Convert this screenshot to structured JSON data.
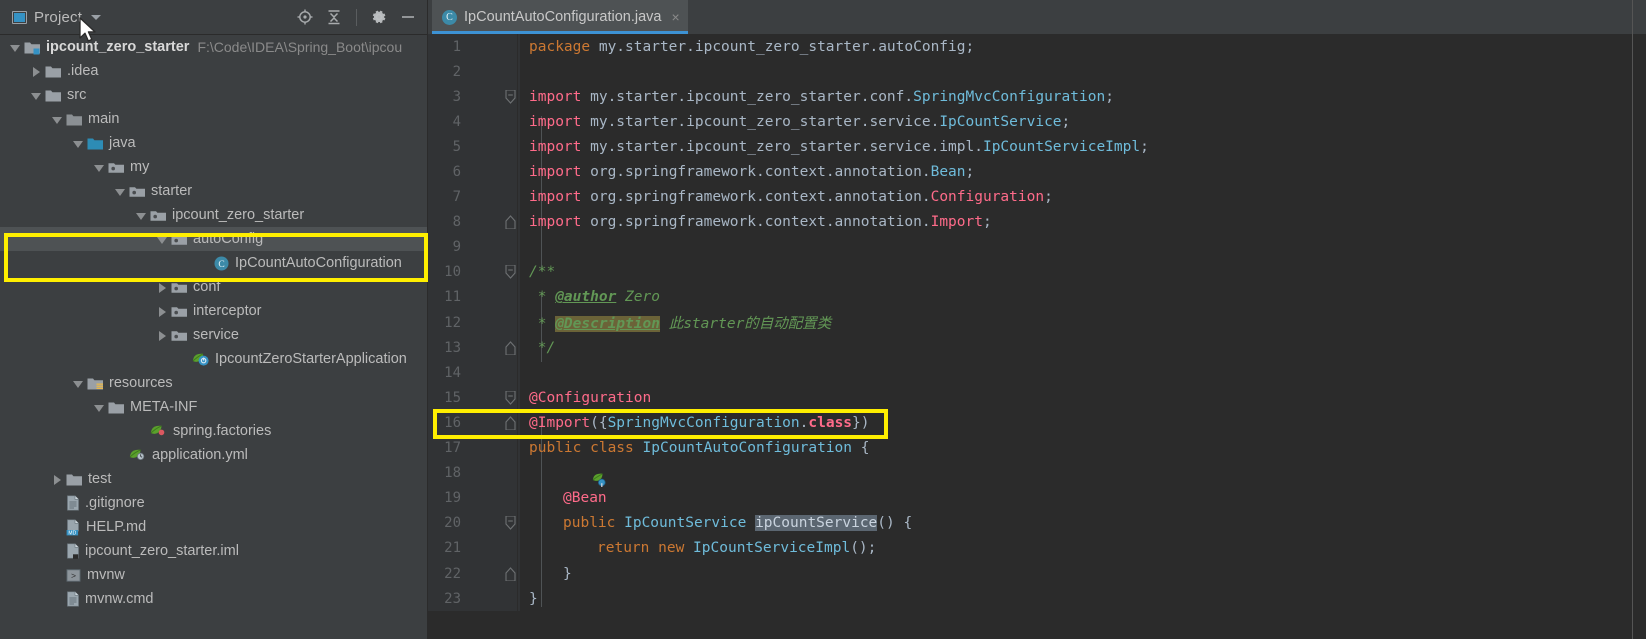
{
  "project_panel": {
    "title": "Project",
    "window_icon": "project-window-icon",
    "dropdown_icon": "chevron-down-icon",
    "toolbar": [
      {
        "name": "locate-icon",
        "tooltip": "Select Opened File"
      },
      {
        "name": "collapse-all-icon",
        "tooltip": "Collapse All"
      },
      {
        "name": "gear-icon",
        "tooltip": "Settings"
      },
      {
        "name": "minimize-icon",
        "tooltip": "Hide"
      }
    ],
    "tree": [
      {
        "label": "ipcount_zero_starter",
        "path": "F:\\Code\\IDEA\\Spring_Boot\\ipcou",
        "indent": 0,
        "arrow": "expanded",
        "icon": "module-folder-icon",
        "bold": true
      },
      {
        "label": ".idea",
        "path": "",
        "indent": 1,
        "arrow": "collapsed",
        "icon": "folder-icon",
        "bold": false
      },
      {
        "label": "src",
        "path": "",
        "indent": 1,
        "arrow": "expanded",
        "icon": "folder-icon",
        "bold": false
      },
      {
        "label": "main",
        "path": "",
        "indent": 2,
        "arrow": "expanded",
        "icon": "folder-plain-icon",
        "bold": false
      },
      {
        "label": "java",
        "path": "",
        "indent": 3,
        "arrow": "expanded",
        "icon": "source-root-icon",
        "bold": false
      },
      {
        "label": "my",
        "path": "",
        "indent": 4,
        "arrow": "expanded",
        "icon": "package-icon",
        "bold": false
      },
      {
        "label": "starter",
        "path": "",
        "indent": 5,
        "arrow": "expanded",
        "icon": "package-icon",
        "bold": false
      },
      {
        "label": "ipcount_zero_starter",
        "path": "",
        "indent": 6,
        "arrow": "expanded",
        "icon": "package-icon",
        "bold": false
      },
      {
        "label": "autoConfig",
        "path": "",
        "indent": 7,
        "arrow": "expanded",
        "icon": "package-icon",
        "bold": false,
        "selected": true
      },
      {
        "label": "IpCountAutoConfiguration",
        "path": "",
        "indent": 9,
        "arrow": "none",
        "icon": "java-class-icon",
        "bold": false
      },
      {
        "label": "conf",
        "path": "",
        "indent": 7,
        "arrow": "collapsed",
        "icon": "package-icon",
        "bold": false
      },
      {
        "label": "interceptor",
        "path": "",
        "indent": 7,
        "arrow": "collapsed",
        "icon": "package-icon",
        "bold": false
      },
      {
        "label": "service",
        "path": "",
        "indent": 7,
        "arrow": "collapsed",
        "icon": "package-icon",
        "bold": false
      },
      {
        "label": "IpcountZeroStarterApplication",
        "path": "",
        "indent": 8,
        "arrow": "none",
        "icon": "spring-class-icon",
        "bold": false
      },
      {
        "label": "resources",
        "path": "",
        "indent": 3,
        "arrow": "expanded",
        "icon": "resource-root-icon",
        "bold": false
      },
      {
        "label": "META-INF",
        "path": "",
        "indent": 4,
        "arrow": "expanded",
        "icon": "folder-icon",
        "bold": false
      },
      {
        "label": "spring.factories",
        "path": "",
        "indent": 6,
        "arrow": "none",
        "icon": "spring-factories-icon",
        "bold": false
      },
      {
        "label": "application.yml",
        "path": "",
        "indent": 5,
        "arrow": "none",
        "icon": "spring-yaml-icon",
        "bold": false
      },
      {
        "label": "test",
        "path": "",
        "indent": 2,
        "arrow": "collapsed",
        "icon": "folder-icon",
        "bold": false
      },
      {
        "label": ".gitignore",
        "path": "",
        "indent": 2,
        "arrow": "none",
        "icon": "file-icon",
        "bold": false
      },
      {
        "label": "HELP.md",
        "path": "",
        "indent": 2,
        "arrow": "none",
        "icon": "markdown-file-icon",
        "bold": false
      },
      {
        "label": "ipcount_zero_starter.iml",
        "path": "",
        "indent": 2,
        "arrow": "none",
        "icon": "iml-file-icon",
        "bold": false
      },
      {
        "label": "mvnw",
        "path": "",
        "indent": 2,
        "arrow": "none",
        "icon": "script-file-icon",
        "bold": false
      },
      {
        "label": "mvnw.cmd",
        "path": "",
        "indent": 2,
        "arrow": "none",
        "icon": "file-icon",
        "bold": false
      }
    ]
  },
  "editor": {
    "tab": {
      "title": "IpCountAutoConfiguration.java",
      "badge": "C",
      "close": "×"
    },
    "line_numbers": [
      1,
      2,
      3,
      4,
      5,
      6,
      7,
      8,
      9,
      10,
      11,
      12,
      13,
      14,
      15,
      16,
      17,
      18,
      19,
      20,
      21,
      22,
      23
    ],
    "code": {
      "l1_kw": "package",
      "l1_rest": " my.starter.ipcount_zero_starter.autoConfig;",
      "l3_kw": "import",
      "l3_pkg": " my.starter.ipcount_zero_starter.conf.",
      "l3_type": "SpringMvcConfiguration",
      "l3_end": ";",
      "l4_kw": "import",
      "l4_pkg": " my.starter.ipcount_zero_starter.service.",
      "l4_type": "IpCountService",
      "l4_end": ";",
      "l5_kw": "import",
      "l5_pkg": " my.starter.ipcount_zero_starter.service.impl.",
      "l5_type": "IpCountServiceImpl",
      "l5_end": ";",
      "l6_kw": "import",
      "l6_pkg": " org.springframework.context.annotation.",
      "l6_type": "Bean",
      "l6_end": ";",
      "l7_kw": "import",
      "l7_pkg": " org.springframework.context.annotation.",
      "l7_type": "Configuration",
      "l7_end": ";",
      "l8_kw": "import",
      "l8_pkg": " org.springframework.context.annotation.",
      "l8_type": "Import",
      "l8_end": ";",
      "l10": "/**",
      "l11_star": " * ",
      "l11_tag": "@author",
      "l11_text": " Zero",
      "l12_star": " * ",
      "l12_tag": "@Description",
      "l12_text": " 此starter的自动配置类",
      "l13": " */",
      "l15": "@Configuration",
      "l16_ann": "@Import",
      "l16_p1": "({",
      "l16_type": "SpringMvcConfiguration",
      "l16_dot": ".",
      "l16_class": "class",
      "l16_p2": "})",
      "l17_kw1": "public",
      "l17_kw2": " class ",
      "l17_type": "IpCountAutoConfiguration",
      "l17_brace": " {",
      "l19": "@Bean",
      "l20_kw": "public ",
      "l20_type": "IpCountService",
      "l20_space": " ",
      "l20_method": "ipCountService",
      "l20_rest": "() {",
      "l21_kw1": "return",
      "l21_kw2": " new ",
      "l21_type": "IpCountServiceImpl",
      "l21_rest": "();",
      "l22": "}",
      "l23": "}"
    },
    "gutter_icons": {
      "line17": [
        "spring-bean-icon",
        "spring-config-icon"
      ],
      "line19": [
        "spring-bean-method-icon"
      ]
    }
  },
  "annotations": {
    "tree_highlight": {
      "name": "highlight-box-autoconfig-package",
      "color": "#ffef00"
    },
    "code_highlight": {
      "name": "highlight-box-import-annotation",
      "color": "#ffef00"
    }
  }
}
